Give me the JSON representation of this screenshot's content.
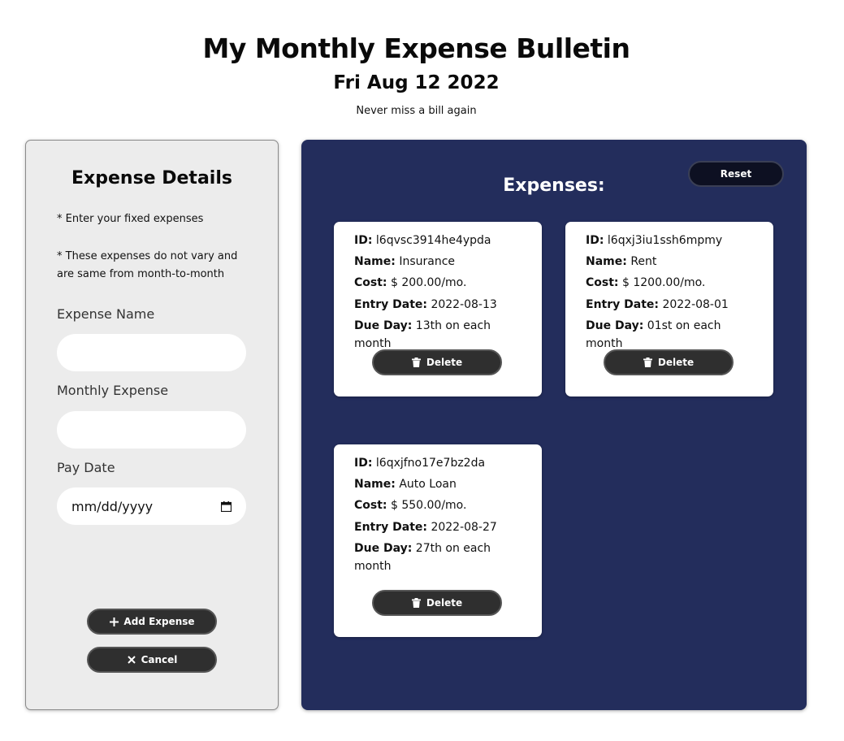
{
  "header": {
    "title": "My Monthly Expense Bulletin",
    "date": "Fri Aug 12 2022",
    "tagline": "Never miss a bill again"
  },
  "form": {
    "title": "Expense Details",
    "note1": "* Enter your fixed expenses",
    "note2": "* These expenses do not vary and are same from month-to-month",
    "name_label": "Expense Name",
    "name_value": "",
    "monthly_label": "Monthly Expense",
    "monthly_value": "",
    "date_label": "Pay Date",
    "date_placeholder": "mm/dd/yyyy",
    "add_label": "Add Expense",
    "cancel_label": "Cancel"
  },
  "list": {
    "title": "Expenses:",
    "reset_label": "Reset",
    "labels": {
      "id": "ID:",
      "name": "Name:",
      "cost": "Cost:",
      "entry": "Entry Date:",
      "due": "Due Day:",
      "delete": "Delete"
    },
    "items": [
      {
        "id": "l6qvsc3914he4ypda",
        "name": "Insurance",
        "cost": "$ 200.00/mo.",
        "entry": "2022-08-13",
        "due": "13th on each month"
      },
      {
        "id": "l6qxj3iu1ssh6mpmy",
        "name": "Rent",
        "cost": "$ 1200.00/mo.",
        "entry": "2022-08-01",
        "due": "01st on each month"
      },
      {
        "id": "l6qxjfno17e7bz2da",
        "name": "Auto Loan",
        "cost": "$ 550.00/mo.",
        "entry": "2022-08-27",
        "due": "27th on each month"
      }
    ]
  }
}
